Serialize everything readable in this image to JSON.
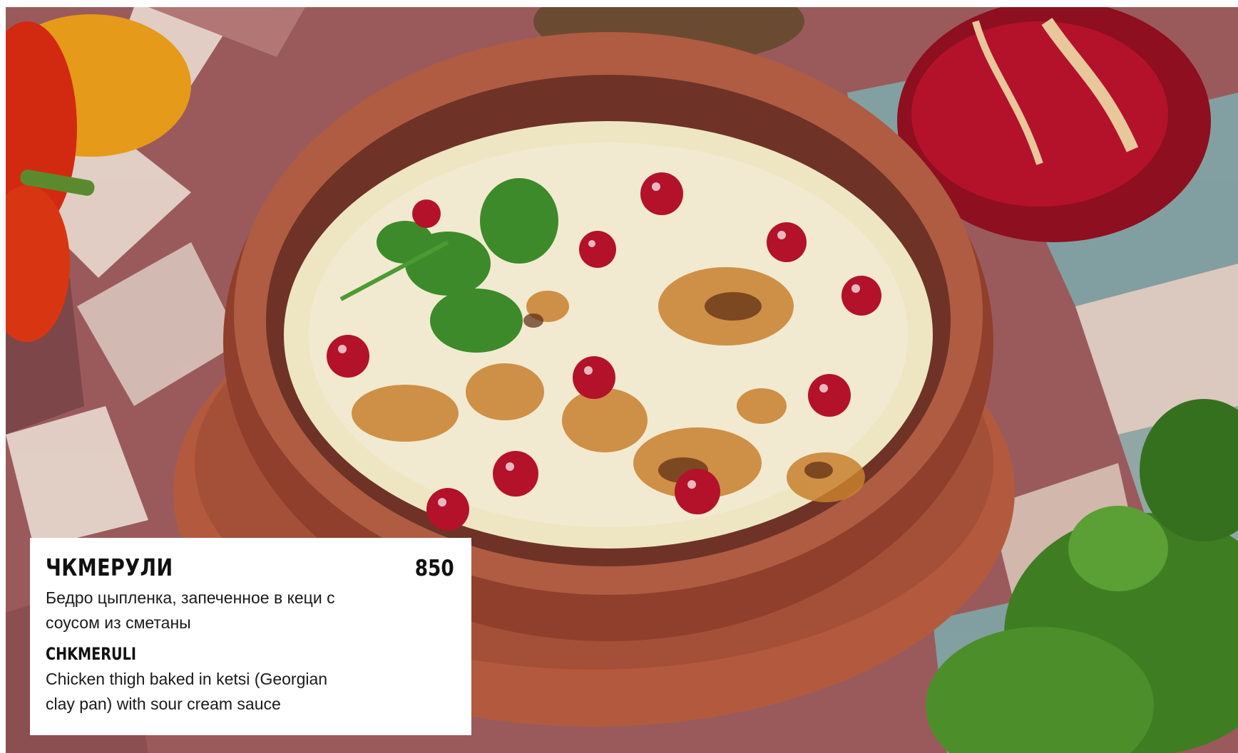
{
  "menu_item": {
    "title_ru": "ЧКМЕРУЛИ",
    "price": "850",
    "description_ru": "Бедро цыпленка, запеченное в кеци с соусом из сметаны",
    "title_en": "CHKMERULI",
    "description_en": "Chicken thigh baked in ketsi (Georgian clay pan) with sour cream sauce"
  },
  "colors": {
    "card_bg": "#ffffff",
    "text": "#111111",
    "clay": "#a8513a",
    "sauce": "#efe8c4",
    "pomegranate": "#b0142a",
    "tile_dark": "#8e4e50",
    "tile_light": "#e8d7cf"
  }
}
